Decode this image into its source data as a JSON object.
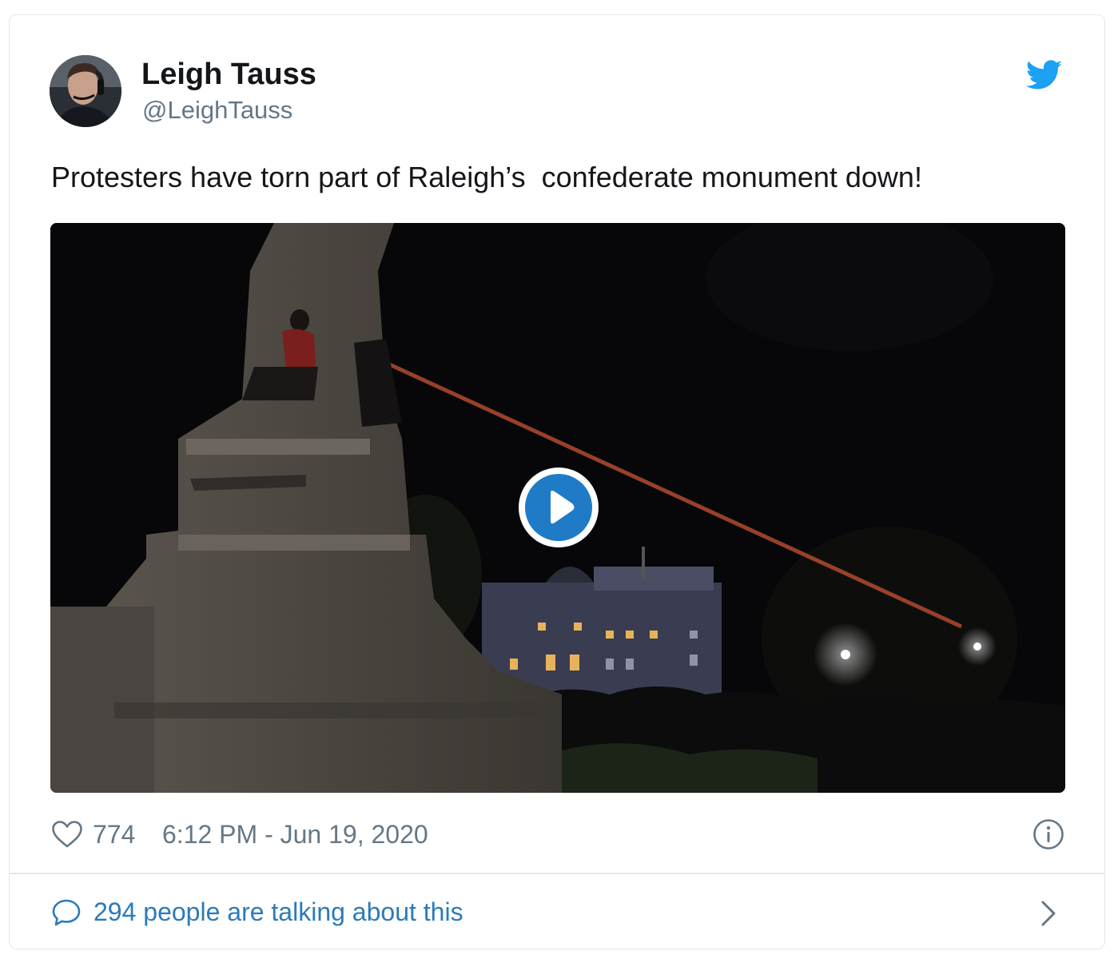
{
  "author": {
    "name": "Leigh Tauss",
    "handle": "@LeighTauss",
    "avatar_icon": "profile-photo"
  },
  "brand": {
    "icon": "twitter-bird-icon",
    "color": "#1da1f2"
  },
  "tweet": {
    "text": "Protesters have torn part of Raleigh’s  confederate monument down!"
  },
  "media": {
    "type": "video",
    "play_icon": "play-icon",
    "play_color": "#1f7bc6"
  },
  "meta": {
    "like_icon": "heart-icon",
    "like_count": "774",
    "timestamp": "6:12 PM - Jun 19, 2020",
    "info_icon": "info-icon"
  },
  "footer": {
    "icon": "speech-bubble-icon",
    "text": "294 people are talking about this",
    "link_color": "#2b7bb9",
    "chevron_icon": "chevron-right-icon"
  }
}
